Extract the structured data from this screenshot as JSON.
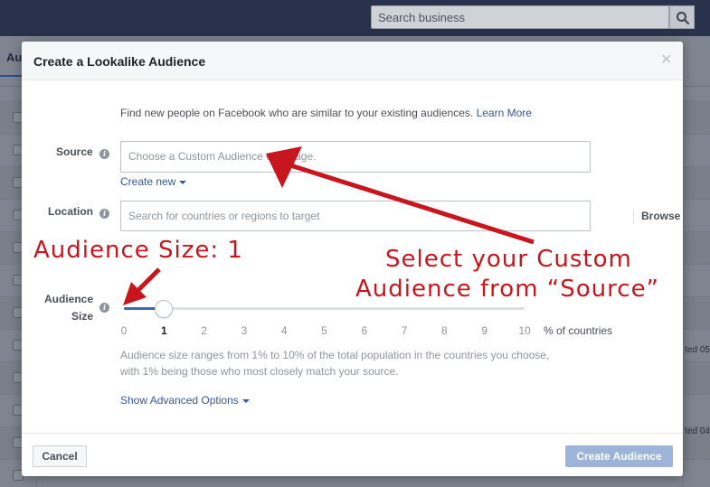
{
  "topbar": {
    "search_placeholder": "Search business",
    "search_icon": "search-icon"
  },
  "background": {
    "tab_label": "Au",
    "side_texts": [
      "ted 05",
      "ted 04"
    ]
  },
  "modal": {
    "title": "Create a Lookalike Audience",
    "close_icon": "close-icon",
    "intro_text": "Find new people on Facebook who are similar to your existing audiences.",
    "learn_more": "Learn More",
    "source": {
      "label": "Source",
      "placeholder": "Choose a Custom Audience or a Page.",
      "create_new": "Create new"
    },
    "location": {
      "label": "Location",
      "placeholder": "Search for countries or regions to target",
      "browse": "Browse"
    },
    "audience_size": {
      "label_line1": "Audience",
      "label_line2": "Size",
      "value": 1,
      "min": 0,
      "max": 10,
      "ticks": [
        "0",
        "1",
        "2",
        "3",
        "4",
        "5",
        "6",
        "7",
        "8",
        "9",
        "10"
      ],
      "unit": "% of countries",
      "help_line1": "Audience size ranges from 1% to 10% of the total population in the countries you choose,",
      "help_line2": "with 1% being those who most closely match your source."
    },
    "advanced": "Show Advanced Options",
    "cancel_label": "Cancel",
    "create_label": "Create Audience"
  },
  "annotations": {
    "size_text": "Audience Size: 1",
    "source_text_line1": "Select your Custom",
    "source_text_line2": "Audience from “Source”",
    "color": "#c8161e"
  },
  "colors": {
    "link": "#365899",
    "slider_fill": "#4267b2",
    "create_button_disabled": "#9cb4d8"
  }
}
